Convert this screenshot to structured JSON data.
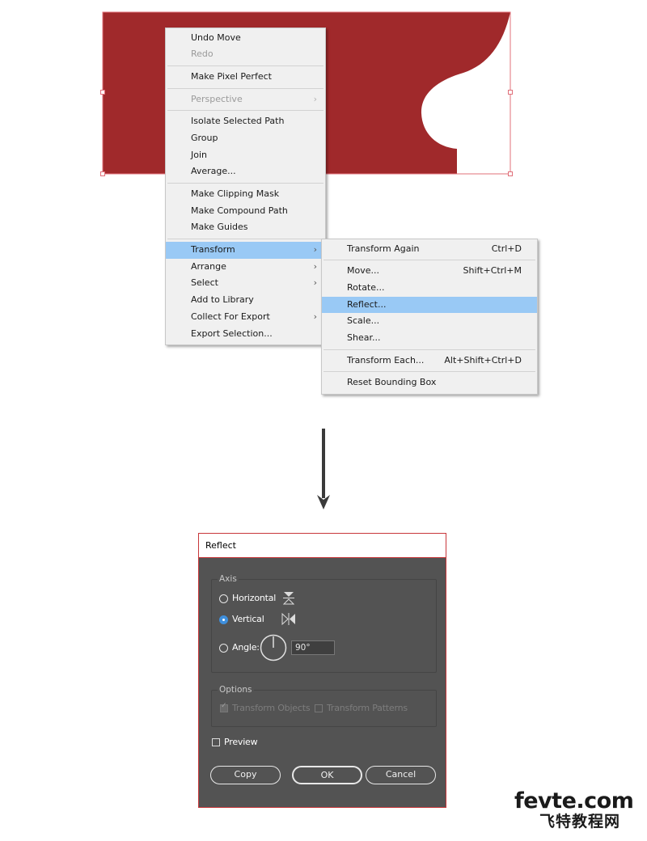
{
  "colors": {
    "artwork_fill": "#a0292b",
    "menu_highlight": "#99c9f5",
    "dialog_bg": "#535353",
    "accent_border": "#c8373a"
  },
  "context_menu": {
    "items": [
      {
        "label": "Undo Move",
        "enabled": true
      },
      {
        "label": "Redo",
        "enabled": false
      },
      {
        "separator": true
      },
      {
        "label": "Make Pixel Perfect",
        "enabled": true
      },
      {
        "separator": true
      },
      {
        "label": "Perspective",
        "enabled": false,
        "submenu": true
      },
      {
        "separator": true
      },
      {
        "label": "Isolate Selected Path",
        "enabled": true
      },
      {
        "label": "Group",
        "enabled": true
      },
      {
        "label": "Join",
        "enabled": true
      },
      {
        "label": "Average...",
        "enabled": true
      },
      {
        "separator": true
      },
      {
        "label": "Make Clipping Mask",
        "enabled": true
      },
      {
        "label": "Make Compound Path",
        "enabled": true
      },
      {
        "label": "Make Guides",
        "enabled": true
      },
      {
        "separator": true
      },
      {
        "label": "Transform",
        "enabled": true,
        "submenu": true,
        "highlighted": true
      },
      {
        "label": "Arrange",
        "enabled": true,
        "submenu": true
      },
      {
        "label": "Select",
        "enabled": true,
        "submenu": true
      },
      {
        "label": "Add to Library",
        "enabled": true
      },
      {
        "label": "Collect For Export",
        "enabled": true,
        "submenu": true
      },
      {
        "label": "Export Selection...",
        "enabled": true
      }
    ]
  },
  "transform_submenu": {
    "items": [
      {
        "label": "Transform Again",
        "shortcut": "Ctrl+D"
      },
      {
        "separator": true
      },
      {
        "label": "Move...",
        "shortcut": "Shift+Ctrl+M"
      },
      {
        "label": "Rotate...",
        "shortcut": ""
      },
      {
        "label": "Reflect...",
        "shortcut": "",
        "highlighted": true
      },
      {
        "label": "Scale...",
        "shortcut": ""
      },
      {
        "label": "Shear...",
        "shortcut": ""
      },
      {
        "separator": true
      },
      {
        "label": "Transform Each...",
        "shortcut": "Alt+Shift+Ctrl+D"
      },
      {
        "separator": true
      },
      {
        "label": "Reset Bounding Box",
        "shortcut": ""
      }
    ]
  },
  "reflect_dialog": {
    "title": "Reflect",
    "axis_label": "Axis",
    "horizontal_label": "Horizontal",
    "vertical_label": "Vertical",
    "angle_label": "Angle:",
    "angle_value": "90°",
    "selected_axis": "vertical",
    "options_label": "Options",
    "transform_objects_label": "Transform Objects",
    "transform_patterns_label": "Transform Patterns",
    "preview_label": "Preview",
    "copy_button": "Copy",
    "ok_button": "OK",
    "cancel_button": "Cancel"
  },
  "watermark": {
    "site": "fevte.com",
    "name": "飞特教程网"
  }
}
